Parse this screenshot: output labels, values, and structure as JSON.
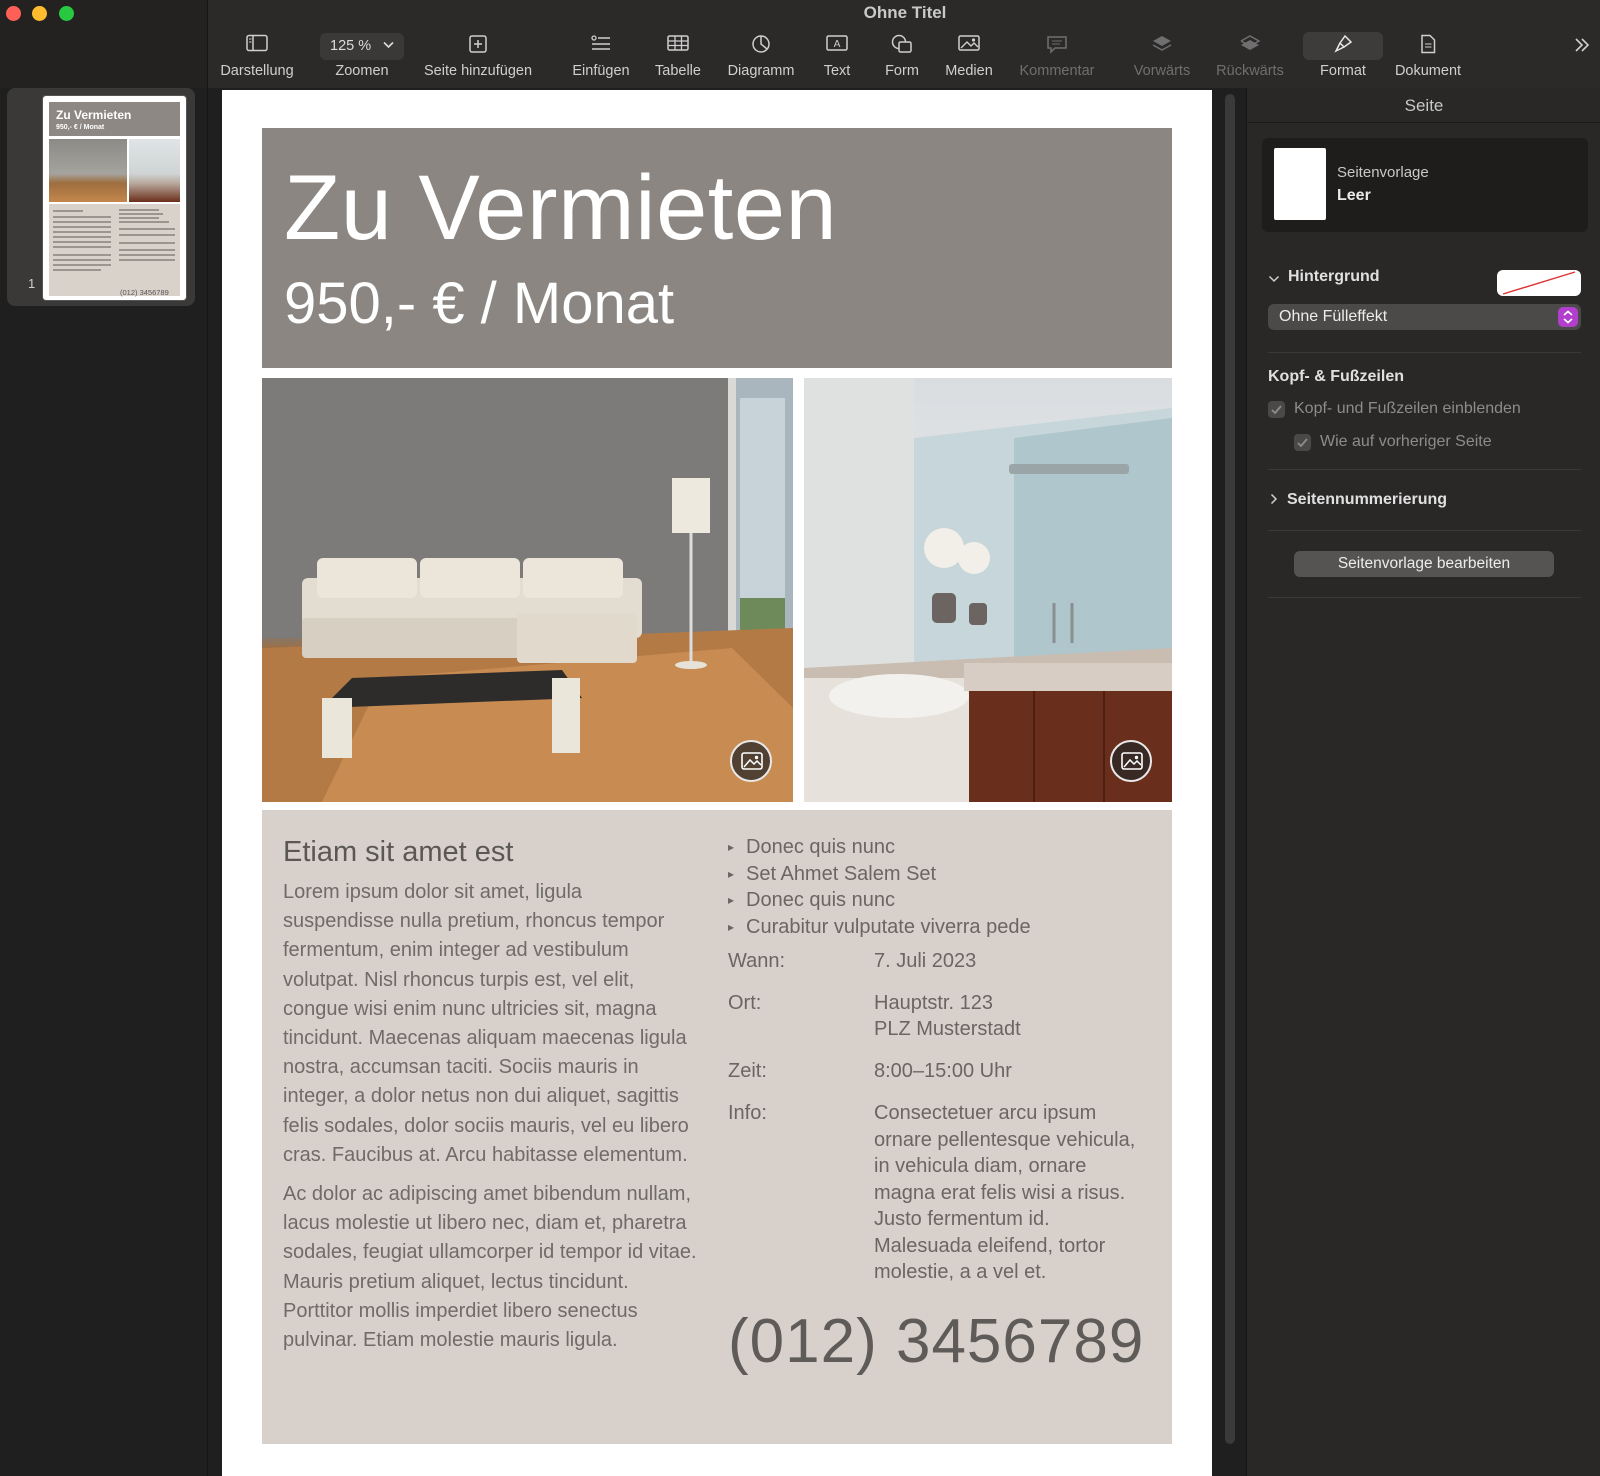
{
  "window": {
    "title": "Ohne Titel"
  },
  "toolbar": {
    "zoom_value": "125 %",
    "items": {
      "view": {
        "label": "Darstellung",
        "icon": "sidebar-icon"
      },
      "zoom": {
        "label": "Zoomen"
      },
      "add_page": {
        "label": "Seite hinzufügen",
        "icon": "add-page-icon"
      },
      "insert": {
        "label": "Einfügen",
        "icon": "insert-list-icon"
      },
      "table": {
        "label": "Tabelle",
        "icon": "table-icon"
      },
      "chart": {
        "label": "Diagramm",
        "icon": "chart-icon"
      },
      "text": {
        "label": "Text",
        "icon": "text-box-icon"
      },
      "shape": {
        "label": "Form",
        "icon": "shape-icon"
      },
      "media": {
        "label": "Medien",
        "icon": "media-icon"
      },
      "comment": {
        "label": "Kommentar",
        "icon": "comment-icon",
        "disabled": true
      },
      "forward": {
        "label": "Vorwärts",
        "icon": "bring-forward-icon",
        "disabled": true
      },
      "backward": {
        "label": "Rückwärts",
        "icon": "send-backward-icon",
        "disabled": true
      },
      "format": {
        "label": "Format",
        "icon": "format-brush-icon",
        "active": true
      },
      "document": {
        "label": "Dokument",
        "icon": "document-icon"
      }
    }
  },
  "thumbnails": {
    "pages": [
      {
        "number": "1",
        "title": "Zu Vermieten",
        "subtitle": "950,- € / Monat",
        "phone": "(012) 3456789"
      }
    ]
  },
  "document": {
    "title": "Zu Vermieten",
    "price": "950,- € / Monat",
    "heading": "Etiam sit amet est",
    "paragraph_1": "Lorem ipsum dolor sit amet, ligula suspendisse nulla pretium, rhoncus tempor fermentum, enim integer ad vestibulum volutpat. Nisl rhoncus turpis est, vel elit, congue wisi enim nunc ultricies sit, magna tincidunt. Maecenas aliquam maecenas ligula nostra, accumsan taciti. Sociis mauris in integer, a dolor netus non dui aliquet, sagittis felis sodales, dolor sociis mauris, vel eu libero cras. Faucibus at. Arcu habitasse elementum.",
    "paragraph_2": "Ac dolor ac adipiscing amet bibendum nullam, lacus molestie ut libero nec, diam et, pharetra sodales, feugiat ullamcorper id tempor id vitae. Mauris pretium aliquet, lectus tincidunt. Porttitor mollis imperdiet libero senectus pulvinar. Etiam molestie mauris ligula.",
    "bullets": [
      "Donec quis nunc",
      "Set Ahmet Salem Set",
      "Donec quis nunc",
      "Curabitur vulputate viverra pede"
    ],
    "details": {
      "when": {
        "label": "Wann:",
        "value": "7. Juli 2023"
      },
      "where": {
        "label": "Ort:",
        "value_line1": "Hauptstr. 123",
        "value_line2": "PLZ Musterstadt"
      },
      "time": {
        "label": "Zeit:",
        "value": "8:00–15:00 Uhr"
      },
      "info": {
        "label": "Info:",
        "value": "Consectetuer arcu ipsum ornare pellentesque vehicula, in vehicula diam, ornare magna erat felis wisi a risus. Justo fermentum id. Malesuada eleifend, tortor molestie, a a vel et."
      }
    },
    "phone": "(012) 3456789",
    "images": [
      {
        "name": "living-room-photo",
        "badge_icon": "image-icon"
      },
      {
        "name": "bathroom-photo",
        "badge_icon": "image-icon"
      }
    ]
  },
  "inspector": {
    "title": "Seite",
    "template": {
      "label": "Seitenvorlage",
      "name": "Leer"
    },
    "background": {
      "label": "Hintergrund",
      "fill_option": "Ohne Fülleffekt",
      "expanded": true
    },
    "header_footer": {
      "label": "Kopf- & Fußzeilen",
      "show_checkbox_label": "Kopf- und Fußzeilen einblenden",
      "same_as_previous_label": "Wie auf vorheriger Seite",
      "show_checked": true,
      "same_as_previous_checked": true
    },
    "page_numbering": {
      "label": "Seitennummerierung",
      "expanded": false
    },
    "edit_template_button": "Seitenvorlage bearbeiten"
  },
  "colors": {
    "header_box": "#8b8681",
    "info_box": "#d8d1cb",
    "accent_stepper": "#b23fcc",
    "close": "#fe5f57",
    "minimize": "#febc2e",
    "zoom": "#28c840"
  }
}
